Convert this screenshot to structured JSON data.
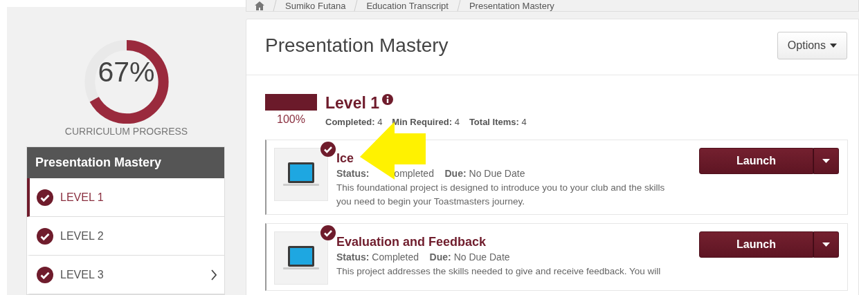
{
  "breadcrumb": [
    {
      "label": "Sumiko Futana"
    },
    {
      "label": "Education Transcript"
    },
    {
      "label": "Presentation Mastery"
    }
  ],
  "progress": {
    "level": 0.67,
    "percent": "67%",
    "label": "CURRICULUM PROGRESS"
  },
  "sidebar": {
    "title": "Presentation Mastery",
    "items": [
      {
        "label": "LEVEL 1",
        "selected": true,
        "completed": true,
        "expandable": false
      },
      {
        "label": "LEVEL 2",
        "selected": false,
        "completed": true,
        "expandable": false
      },
      {
        "label": "LEVEL 3",
        "selected": false,
        "completed": true,
        "expandable": true
      }
    ]
  },
  "page": {
    "title": "Presentation Mastery",
    "options": "Options"
  },
  "level_block": {
    "title": "Level 1",
    "level": 1,
    "percent": "100%",
    "stats": [
      {
        "label": "Completed:",
        "value": "4"
      },
      {
        "label": "Min Required:",
        "value": "4"
      },
      {
        "label": "Total Items:",
        "value": "4"
      }
    ]
  },
  "items": [
    {
      "title": "Ice",
      "completed": true,
      "pointer_arrow": true,
      "status_label": "Status:",
      "status": "ompleted",
      "due_label": "Due:",
      "due": "No Due Date",
      "description": "This foundational project is designed to introduce you to your club and the skills you need to begin your Toastmasters journey.",
      "launch": "Launch"
    },
    {
      "title": "Evaluation and Feedback",
      "completed": true,
      "pointer_arrow": false,
      "status_label": "Status:",
      "status": "Completed",
      "due_label": "Due:",
      "due": "No Due Date",
      "description": "This project addresses the skills needed to give and receive feedback. You will",
      "launch": "Launch"
    }
  ]
}
